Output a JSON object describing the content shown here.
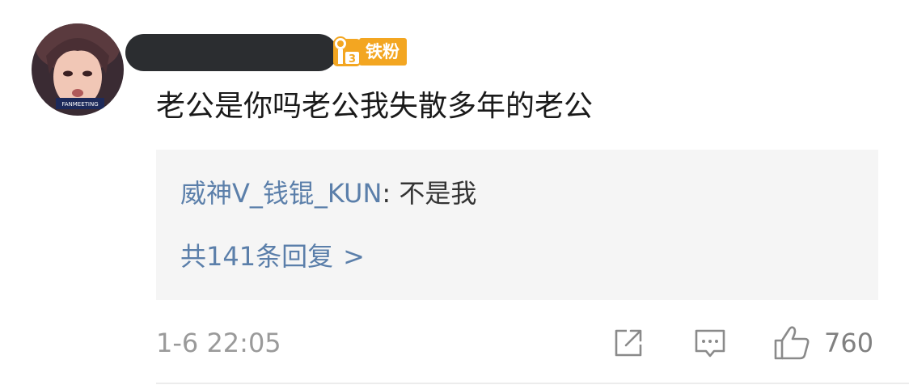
{
  "user": {
    "fan_badge": "铁粉",
    "avatar_caption": "FANMEETING"
  },
  "comment": {
    "text": "老公是你吗老公我失散多年的老公",
    "time": "1-6 22:05",
    "like_count": "760"
  },
  "reply_preview": {
    "author": "威神V_钱锟_KUN",
    "separator": ": ",
    "text": "不是我",
    "more_text": "共141条回复",
    "more_chevron": ">"
  },
  "icons": {
    "share": "share-icon",
    "reply": "comment-icon",
    "like": "thumbs-up-icon",
    "badge": "fan-level-icon"
  },
  "colors": {
    "link_blue": "#5b7faa",
    "badge_orange": "#f3a621",
    "reply_bg": "#f5f5f5",
    "meta_gray": "#9a9a9a"
  }
}
